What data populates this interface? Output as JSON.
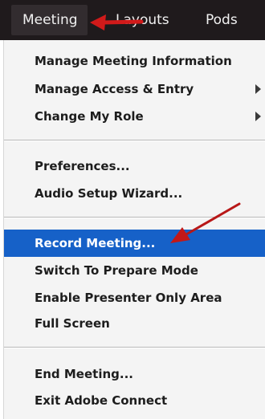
{
  "menubar": {
    "tabs": [
      {
        "label": "Meeting"
      },
      {
        "label": "Layouts"
      },
      {
        "label": "Pods"
      }
    ]
  },
  "menu": {
    "group1": [
      {
        "label": "Manage Meeting Information",
        "submenu": false
      },
      {
        "label": "Manage Access & Entry",
        "submenu": true
      },
      {
        "label": "Change My Role",
        "submenu": true
      }
    ],
    "group2": [
      {
        "label": "Preferences..."
      },
      {
        "label": "Audio Setup Wizard..."
      }
    ],
    "group3": [
      {
        "label": "Record Meeting...",
        "highlighted": true
      },
      {
        "label": "Switch To Prepare Mode"
      },
      {
        "label": "Enable Presenter Only Area"
      },
      {
        "label": "Full Screen"
      }
    ],
    "group4": [
      {
        "label": "End Meeting..."
      },
      {
        "label": "Exit Adobe Connect"
      }
    ]
  },
  "colors": {
    "menubar_bg": "#1f1a1c",
    "highlight_bg": "#1661c8",
    "annotation_arrow": "#d11a1a"
  }
}
